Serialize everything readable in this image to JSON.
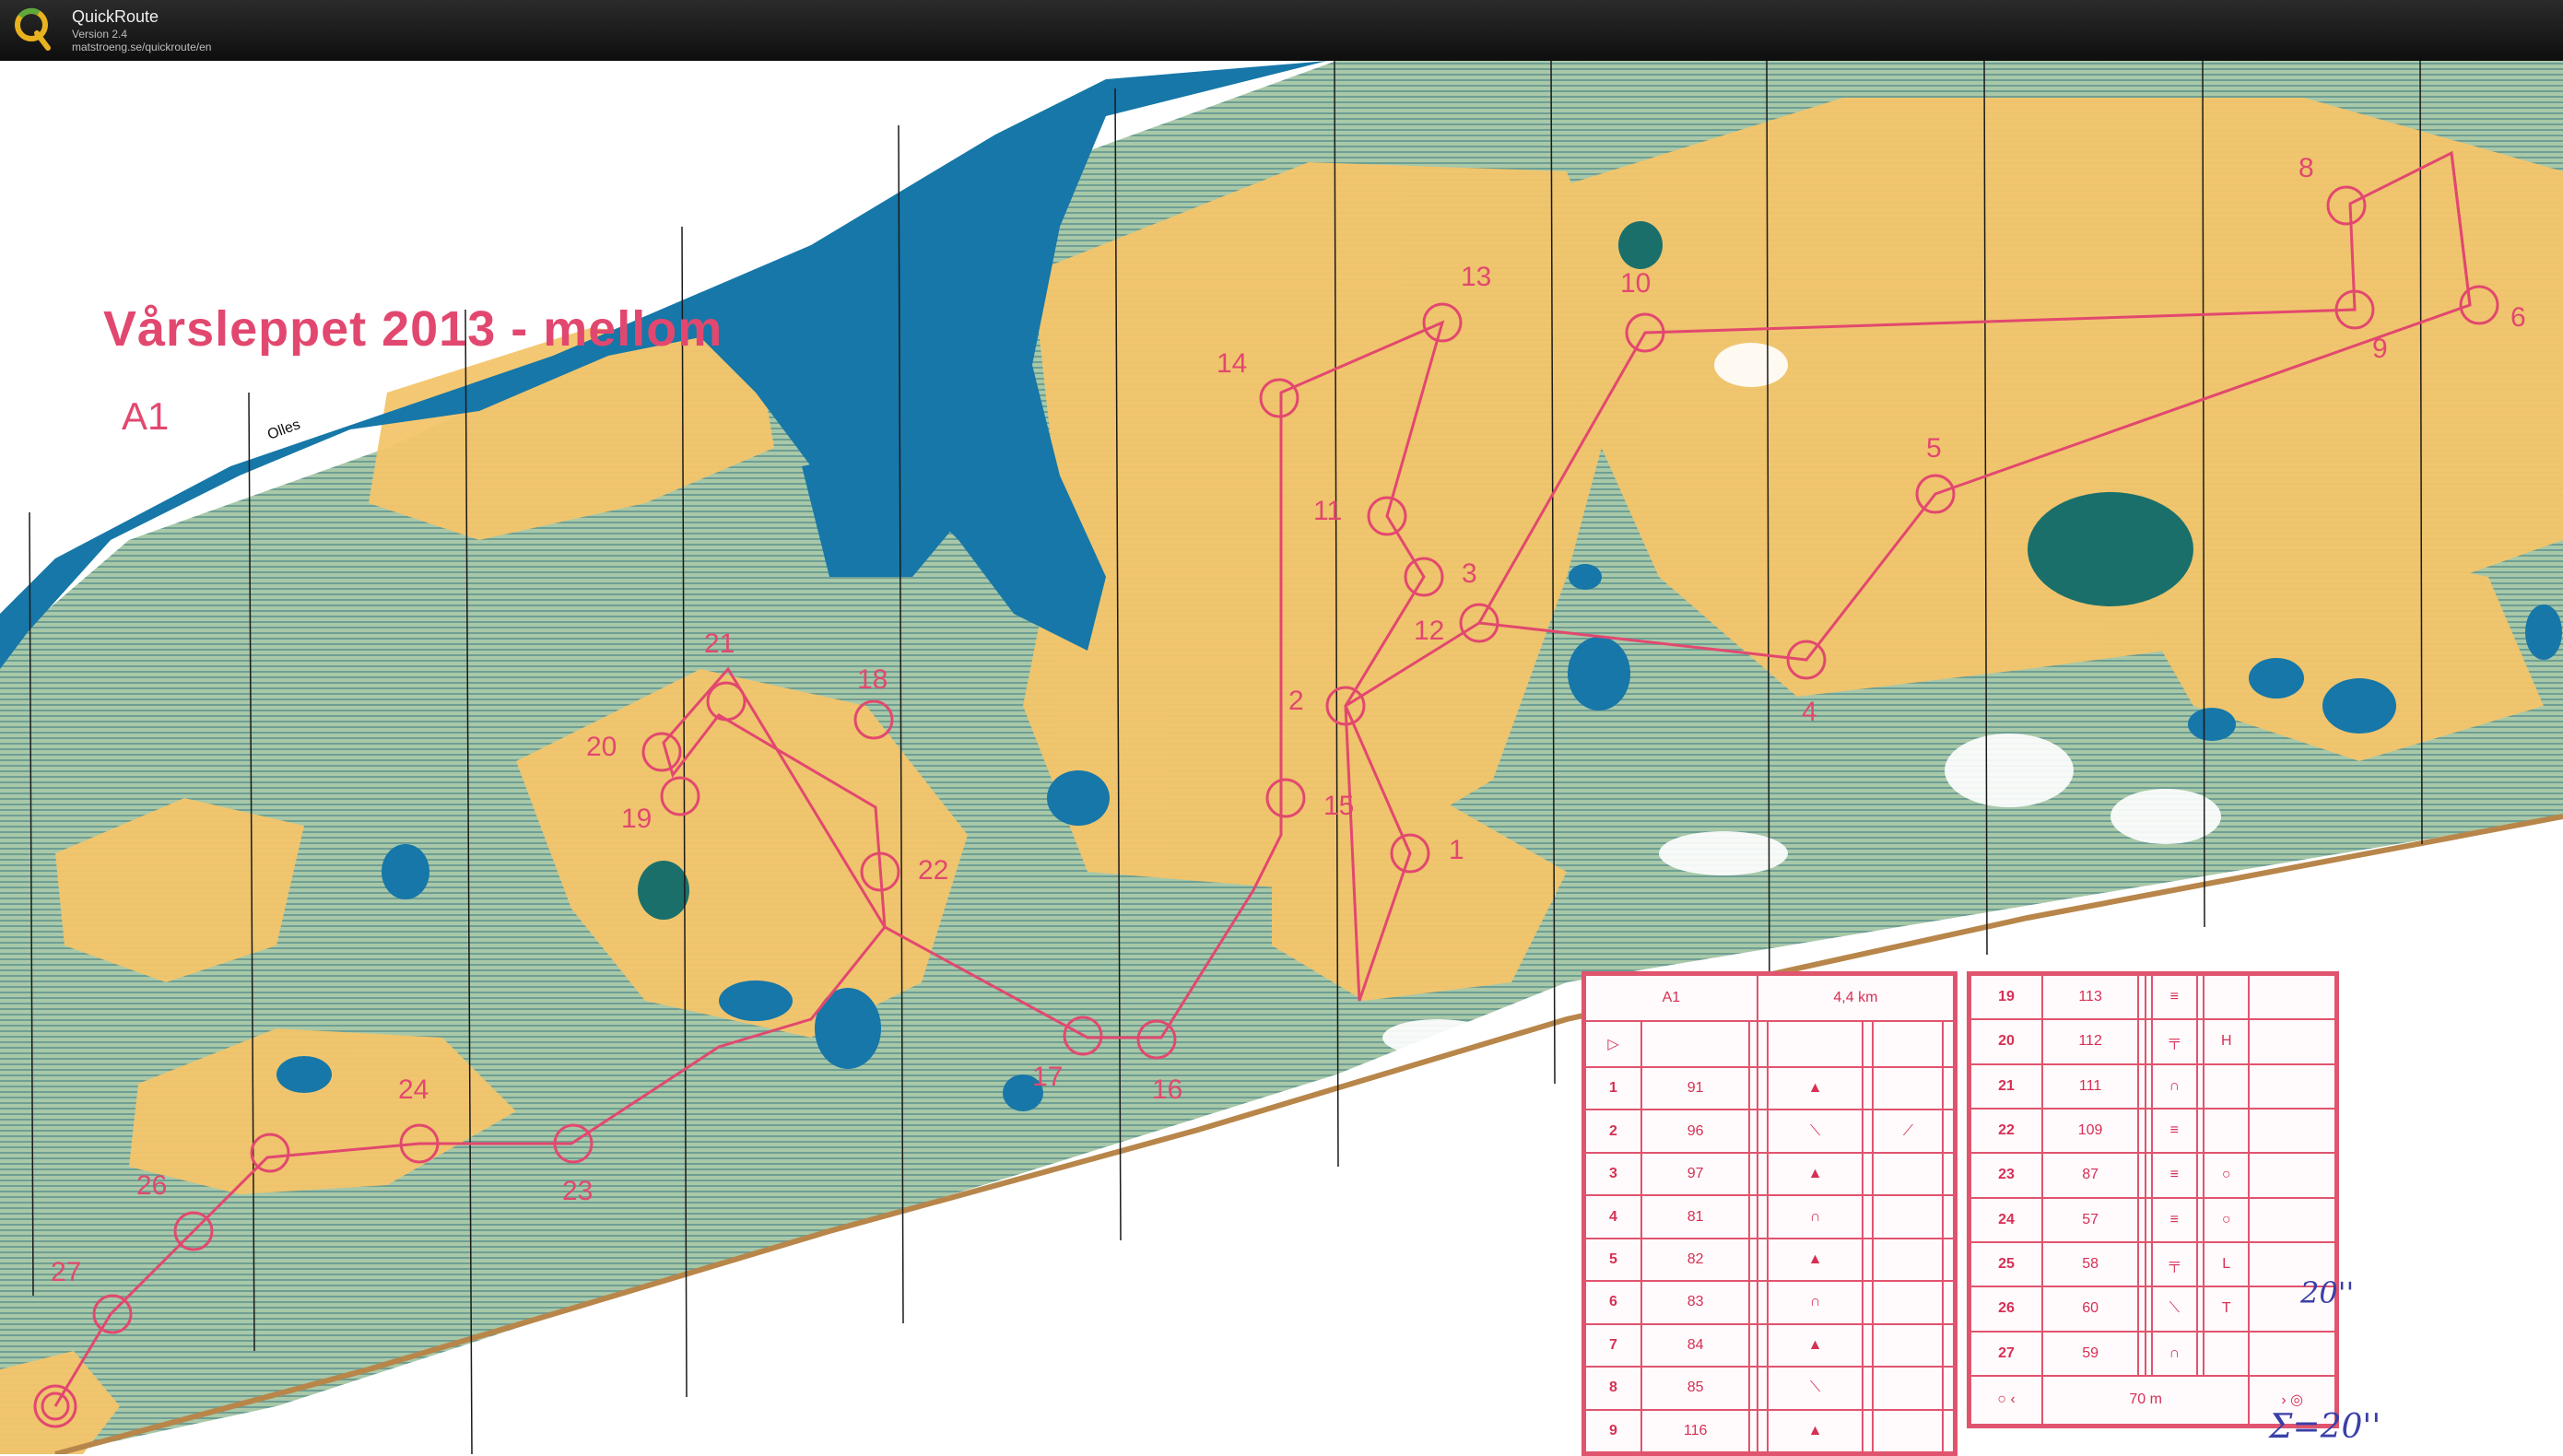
{
  "window": {
    "app_name": "QuickRoute",
    "version": "Version 2.4",
    "url": "matstroeng.se/quickroute/en"
  },
  "map": {
    "title": "Vårsleppet 2013 - mellom",
    "course": "A1",
    "place_name": "Olles",
    "colors": {
      "water": "#1677a8",
      "open_land": "#f3c56a",
      "vegetation": "#8fb7a2",
      "course_line": "#e2486f",
      "paper": "#ffffff"
    },
    "control_labels": [
      "1",
      "2",
      "3",
      "4",
      "5",
      "6",
      "8",
      "9",
      "10",
      "11",
      "12",
      "13",
      "14",
      "15",
      "16",
      "17",
      "18",
      "19",
      "20",
      "21",
      "22",
      "23",
      "24",
      "26",
      "27"
    ]
  },
  "control_description": {
    "header": {
      "course": "A1",
      "length": "4,4 km"
    },
    "left_rows": [
      {
        "n": "1",
        "code": "91",
        "sym": "▲",
        "ext": ""
      },
      {
        "n": "2",
        "code": "96",
        "sym": "⟍",
        "ext": "⟋"
      },
      {
        "n": "3",
        "code": "97",
        "sym": "▲",
        "ext": ""
      },
      {
        "n": "4",
        "code": "81",
        "sym": "∩",
        "ext": ""
      },
      {
        "n": "5",
        "code": "82",
        "sym": "▲",
        "ext": ""
      },
      {
        "n": "6",
        "code": "83",
        "sym": "∩",
        "ext": ""
      },
      {
        "n": "7",
        "code": "84",
        "sym": "▲",
        "ext": ""
      },
      {
        "n": "8",
        "code": "85",
        "sym": "⟍",
        "ext": ""
      },
      {
        "n": "9",
        "code": "116",
        "sym": "▲",
        "ext": ""
      }
    ],
    "right_rows": [
      {
        "n": "19",
        "code": "113",
        "sym": "≡",
        "ext": ""
      },
      {
        "n": "20",
        "code": "112",
        "sym": "╤",
        "ext": "H"
      },
      {
        "n": "21",
        "code": "111",
        "sym": "∩",
        "ext": ""
      },
      {
        "n": "22",
        "code": "109",
        "sym": "≡",
        "ext": ""
      },
      {
        "n": "23",
        "code": "87",
        "sym": "≡",
        "ext": "○"
      },
      {
        "n": "24",
        "code": "57",
        "sym": "≡",
        "ext": "○"
      },
      {
        "n": "25",
        "code": "58",
        "sym": "╤",
        "ext": "L"
      },
      {
        "n": "26",
        "code": "60",
        "sym": "⟍",
        "ext": "T"
      },
      {
        "n": "27",
        "code": "59",
        "sym": "∩",
        "ext": ""
      }
    ],
    "finish": "70 m",
    "handwritten_note": "20''",
    "handwritten_sum": "Σ=20''"
  }
}
